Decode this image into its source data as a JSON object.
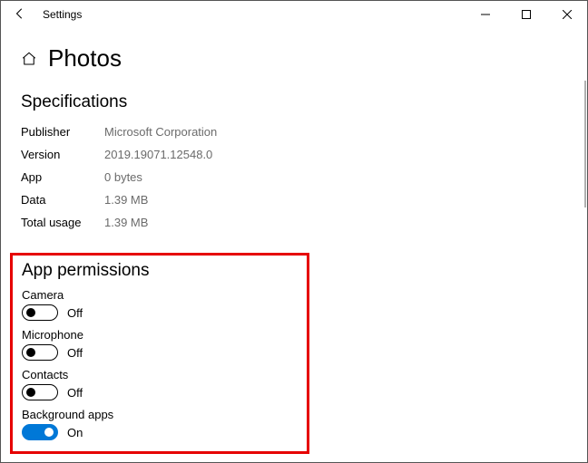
{
  "window": {
    "title": "Settings"
  },
  "page": {
    "title": "Photos"
  },
  "specs": {
    "heading": "Specifications",
    "rows": [
      {
        "label": "Publisher",
        "value": "Microsoft Corporation"
      },
      {
        "label": "Version",
        "value": "2019.19071.12548.0"
      },
      {
        "label": "App",
        "value": "0 bytes"
      },
      {
        "label": "Data",
        "value": "1.39 MB"
      },
      {
        "label": "Total usage",
        "value": "1.39 MB"
      }
    ]
  },
  "permissions": {
    "heading": "App permissions",
    "items": [
      {
        "label": "Camera",
        "on": false,
        "state": "Off"
      },
      {
        "label": "Microphone",
        "on": false,
        "state": "Off"
      },
      {
        "label": "Contacts",
        "on": false,
        "state": "Off"
      },
      {
        "label": "Background apps",
        "on": true,
        "state": "On"
      }
    ]
  }
}
